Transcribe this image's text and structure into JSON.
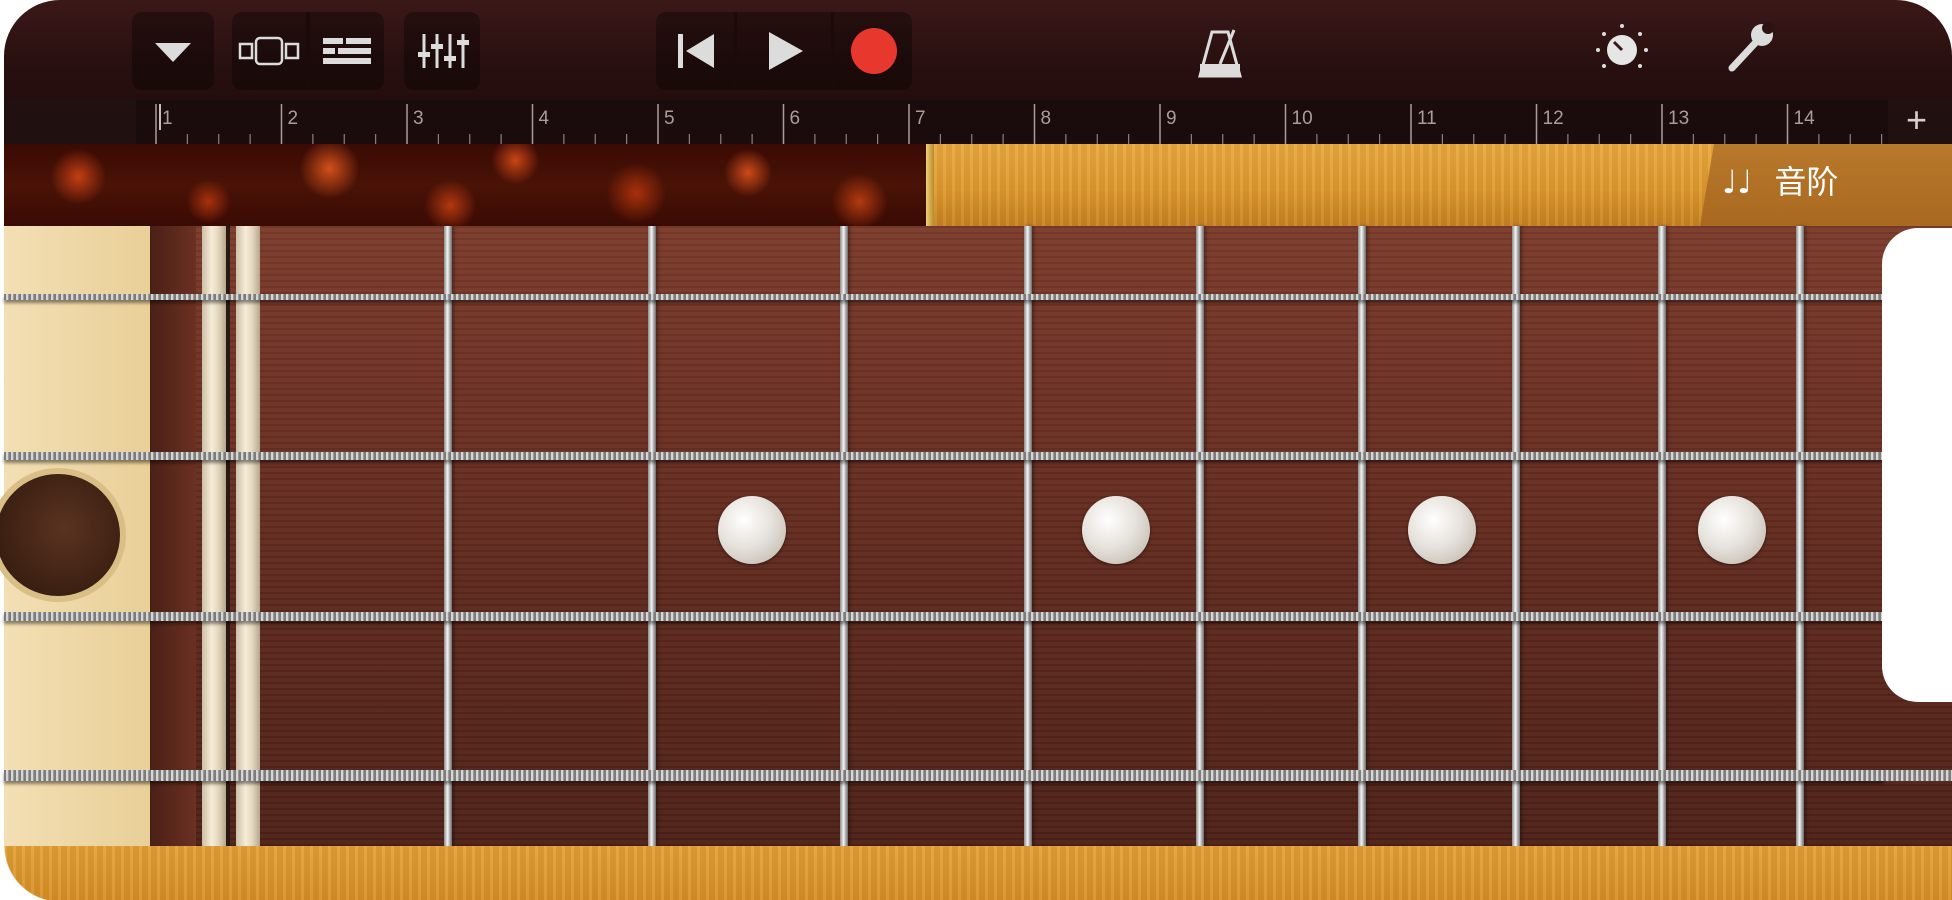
{
  "toolbar": {
    "browser_button": "browser-dropdown",
    "track_view_button": "tracks-view",
    "smart_controls_button": "track-controls",
    "mixer_button": "mixer",
    "rewind_button": "go-to-beginning",
    "play_button": "play",
    "record_button": "record",
    "metronome_button": "metronome",
    "master_effects_button": "master-effects",
    "settings_button": "settings",
    "record_color": "#e8382e"
  },
  "ruler": {
    "bars": [
      "1",
      "2",
      "3",
      "4",
      "5",
      "6",
      "7",
      "8",
      "9",
      "10",
      "11",
      "12",
      "13",
      "14"
    ],
    "add_section": "+"
  },
  "scale_button": {
    "icon": "♩♩",
    "label": "音阶"
  },
  "fretboard": {
    "strings": 4,
    "inlay_frets": [
      3,
      5,
      7,
      9
    ]
  }
}
